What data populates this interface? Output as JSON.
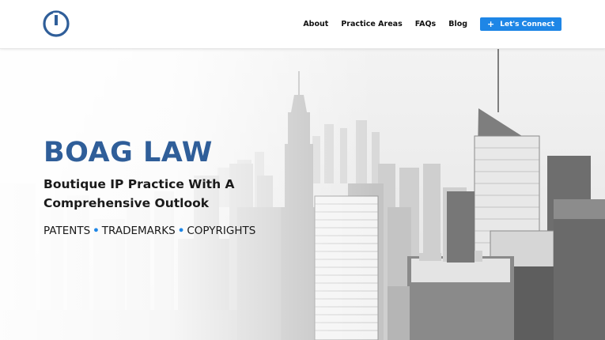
{
  "header": {
    "logo_icon": "power-icon",
    "brand_color": "#2f5e99",
    "nav": [
      {
        "label": "About"
      },
      {
        "label": "Practice Areas"
      },
      {
        "label": "FAQs"
      },
      {
        "label": "Blog"
      }
    ],
    "cta": {
      "icon": "plus-icon",
      "label": "Let's Connect",
      "color": "#1e86e6"
    }
  },
  "hero": {
    "title": "BOAG LAW",
    "subtitle": "Boutique IP Practice With A Comprehensive Outlook",
    "services": [
      "PATENTS",
      "TRADEMARKS",
      "COPYRIGHTS"
    ],
    "separator": "•",
    "background": "city-skyline-photo"
  }
}
